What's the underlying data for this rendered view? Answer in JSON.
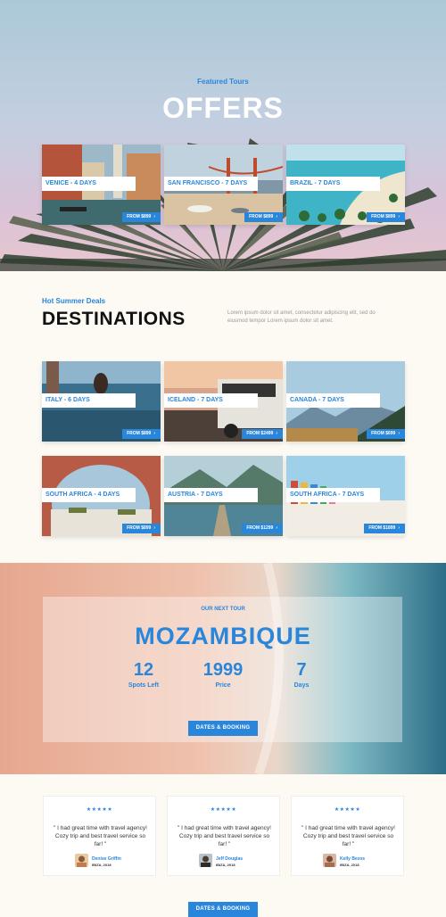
{
  "hero": {
    "subtitle": "Featured Tours",
    "title": "OFFERS"
  },
  "offers": [
    {
      "label": "VENICE - 4 DAYS",
      "price": "FROM $899"
    },
    {
      "label": "SAN FRANCISCO - 7 DAYS",
      "price": "FROM $899"
    },
    {
      "label": "BRAZIL - 7 DAYS",
      "price": "FROM $899"
    }
  ],
  "destinations": {
    "subtitle": "Hot Summer Deals",
    "title": "DESTINATIONS",
    "text": "Lorem ipsum dolor sit amet, consectetur adipiscing elit, sed do eiusmod tempor Lorem ipsum dolor sit amet.",
    "cards": [
      {
        "label": "ITALY - 6 DAYS",
        "price": "FROM $899"
      },
      {
        "label": "ICELAND - 7 DAYS",
        "price": "FROM $2499"
      },
      {
        "label": "CANADA - 7 DAYS",
        "price": "FROM $699"
      },
      {
        "label": "SOUTH AFRICA - 4 DAYS",
        "price": "FROM $899"
      },
      {
        "label": "AUSTRIA - 7 DAYS",
        "price": "FROM $1299"
      },
      {
        "label": "SOUTH AFRICA - 7 DAYS",
        "price": "FROM $1899"
      }
    ]
  },
  "next_tour": {
    "subtitle": "OUR NEXT TOUR",
    "title": "MOZAMBIQUE",
    "stats": [
      {
        "value": "12",
        "caption": "Spots Left"
      },
      {
        "value": "1999",
        "caption": "Price"
      },
      {
        "value": "7",
        "caption": "Days"
      }
    ],
    "button": "DATES & BOOKING"
  },
  "testimonials": [
    {
      "stars": "★★★★★",
      "quote": "\" I had great time with travel agency! Cozy trip and best travel service so far! \"",
      "name": "Denise Griffin",
      "meta": "IBIZA, 2018"
    },
    {
      "stars": "★★★★★",
      "quote": "\" I had great time with travel agency! Cozy trip and best travel service so far! \"",
      "name": "Jeff Douglas",
      "meta": "IBIZA, 2018"
    },
    {
      "stars": "★★★★★",
      "quote": "\" I had great time with travel agency! Cozy trip and best travel service so far! \"",
      "name": "Kelly Bezos",
      "meta": "IBIZA, 2018"
    }
  ],
  "footer_button": "DATES & BOOKING",
  "colors": {
    "accent": "#2a86db",
    "background": "#fdfaf4"
  },
  "icons": {
    "price_arrow": "chevron-right-icon",
    "rating": "star-icon"
  }
}
